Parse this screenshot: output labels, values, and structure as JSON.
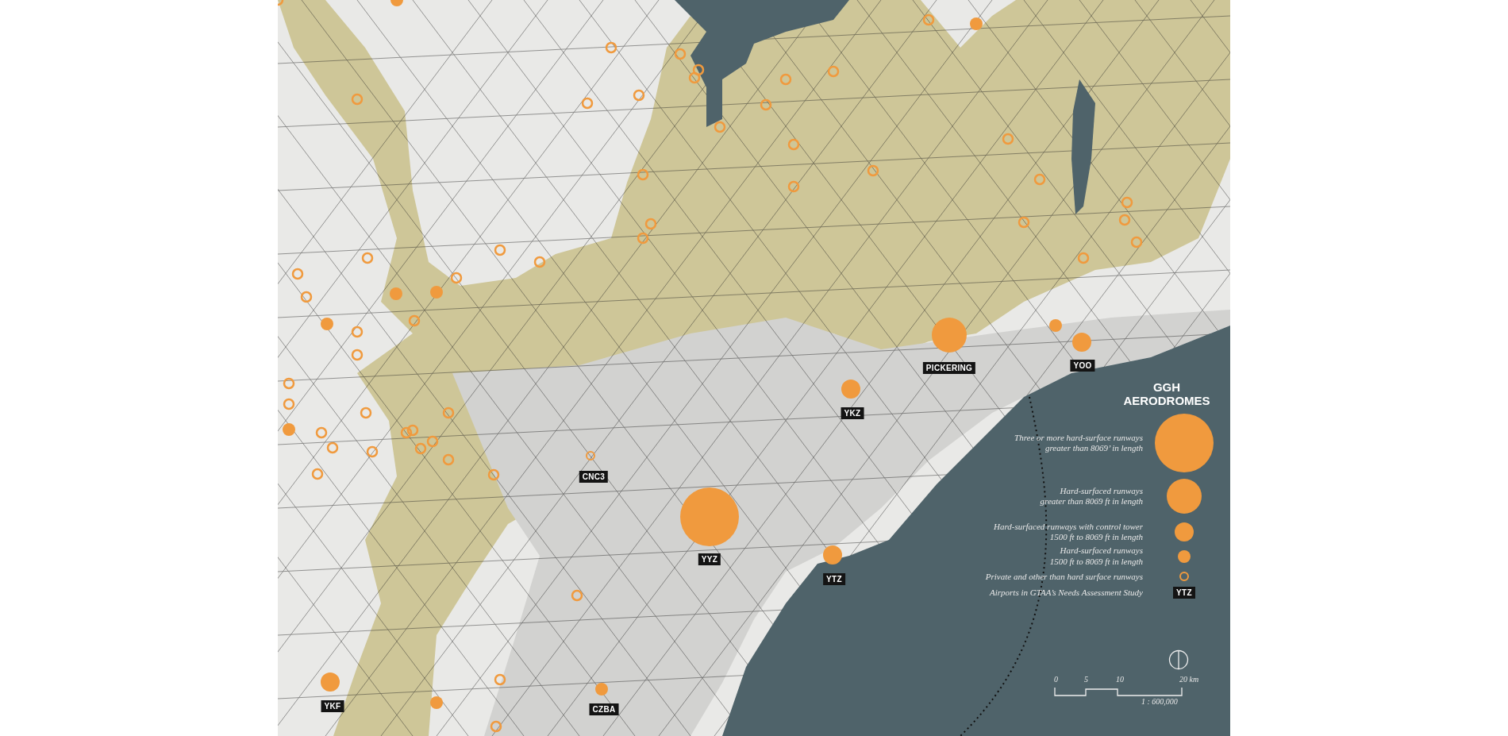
{
  "map": {
    "airports": [
      {
        "code": "YKF",
        "kind": "small"
      },
      {
        "code": "CZBA",
        "kind": "minor"
      },
      {
        "code": "CNC3",
        "kind": "private"
      },
      {
        "code": "YYZ",
        "kind": "major"
      },
      {
        "code": "YTZ",
        "kind": "small"
      },
      {
        "code": "YKZ",
        "kind": "small"
      },
      {
        "code": "PICKERING",
        "kind": "large"
      },
      {
        "code": "YOO",
        "kind": "small"
      }
    ]
  },
  "legend": {
    "title": "GGH AERODROMES",
    "items": [
      {
        "kind": "major",
        "lines": [
          "Three or more hard-surface runways",
          "greater than 8069’ in length"
        ]
      },
      {
        "kind": "large",
        "lines": [
          "Hard-surfaced runways",
          "greater than 8069 ft in length"
        ]
      },
      {
        "kind": "small",
        "lines": [
          "Hard-surfaced runways with control tower",
          "1500 ft to 8069 ft in length"
        ]
      },
      {
        "kind": "minor",
        "lines": [
          "Hard-surfaced runways",
          "1500 ft to 8069 ft in length"
        ]
      },
      {
        "kind": "private",
        "lines": [
          "Private and other than hard surface runways"
        ]
      },
      {
        "kind": "study",
        "lines": [
          "Airports in GTAA’s Needs Assessment Study"
        ],
        "code": "YTZ"
      }
    ]
  },
  "scale": {
    "ticks": [
      "0",
      "5",
      "10",
      "20 km"
    ],
    "ratio": "1 : 600,000"
  }
}
